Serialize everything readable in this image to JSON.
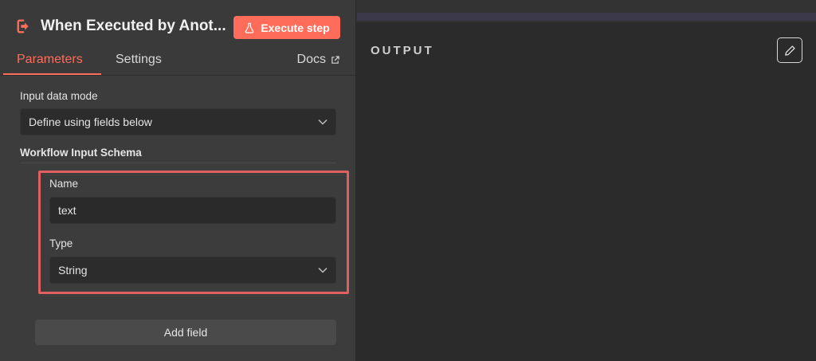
{
  "node": {
    "title": "When Executed by Anot...",
    "icon": "sign-in-arrow-icon",
    "execute_label": "Execute step"
  },
  "tabs": {
    "parameters": "Parameters",
    "settings": "Settings",
    "docs": "Docs"
  },
  "params": {
    "input_mode_label": "Input data mode",
    "input_mode_value": "Define using fields below",
    "schema_label": "Workflow Input Schema",
    "name_label": "Name",
    "name_value": "text",
    "type_label": "Type",
    "type_value": "String",
    "add_field_label": "Add field"
  },
  "output": {
    "label": "OUTPUT"
  },
  "colors": {
    "accent": "#ff6d5a",
    "highlight": "#e06060",
    "background": "#2b2b2b"
  }
}
